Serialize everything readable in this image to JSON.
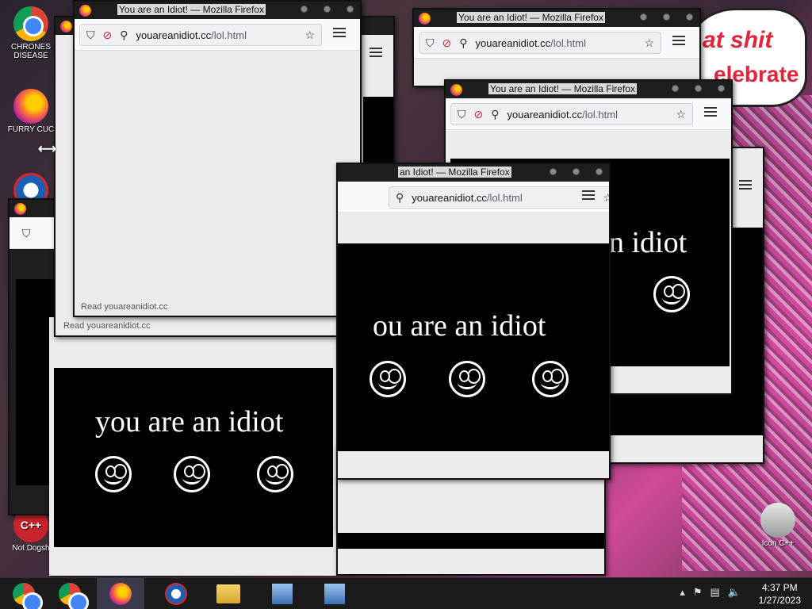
{
  "desktop": {
    "art_text_1": "at shit",
    "art_text_2": "elebrate",
    "icons": [
      {
        "label": "CHRONES DISEASE",
        "icon": "chrome-icon"
      },
      {
        "label": "FURRY CUC",
        "icon": "firefox-icon"
      },
      {
        "label": "",
        "icon": "obama-logo-icon"
      },
      {
        "label": "Not Dogsh",
        "icon": "cpp-icon"
      },
      {
        "label": "Icon C++",
        "icon": "recycle-bin-icon"
      }
    ]
  },
  "windows": {
    "title": "You are an Idiot! — Mozilla Firefox",
    "title_partial": "an Idiot! — Mozilla Firefox",
    "url_domain": "youareanidiot.cc",
    "url_path": "/lol.html",
    "status_text": "Read youareanidiot.cc",
    "content_text": "you are an idiot",
    "content_text_partial_1": "ou are an idiot",
    "content_text_partial_2": "n idiot"
  },
  "taskbar": {
    "apps": [
      "chrome-icon",
      "firefox-icon",
      "obama-logo-icon",
      "file-explorer-icon",
      "installer-icon",
      "installer-icon"
    ],
    "clock_time": "4:37 PM",
    "clock_date": "1/27/2023"
  },
  "colors": {
    "window_frame": "#1e1e1e",
    "content_bg": "#000000",
    "accent_red": "#e0243a"
  }
}
